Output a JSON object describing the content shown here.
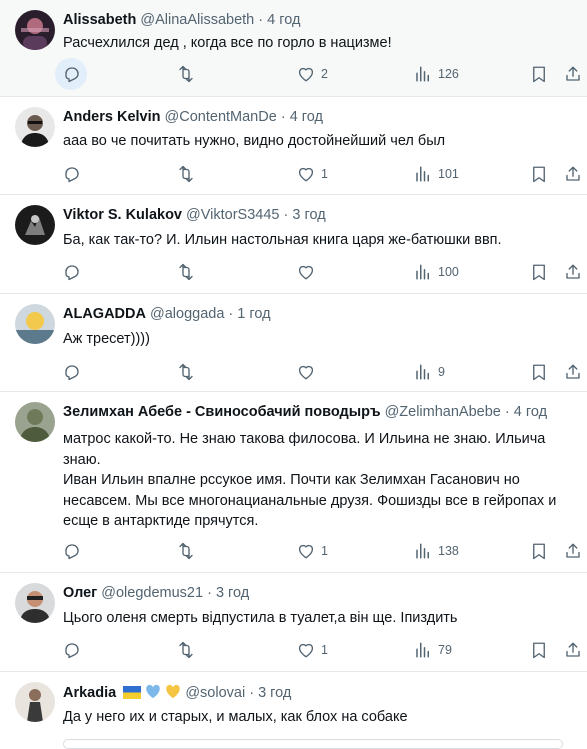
{
  "colors": {
    "text": "#0f1419",
    "muted": "#536471",
    "divider": "#e6e9eb",
    "highlight": "#f7f9f9",
    "reply_highlight": "#e2eef9"
  },
  "replies": [
    {
      "name": "Alissabeth",
      "handle": "@AlinaAlissabeth",
      "dot": "·",
      "time": "4 год",
      "lines": [
        "Расчехлился дед , когда все по горло в нацизме!"
      ],
      "counts": {
        "replies": "",
        "retweets": "",
        "likes": "2",
        "views": "126"
      },
      "highlighted": true
    },
    {
      "name": "Anders Kelvin",
      "handle": "@ContentManDe",
      "dot": "·",
      "time": "4 год",
      "lines": [
        "ааа во че почитать нужно, видно достойнейший чел был"
      ],
      "counts": {
        "replies": "",
        "retweets": "",
        "likes": "1",
        "views": "101"
      }
    },
    {
      "name": "Viktor S. Kulakov",
      "handle": "@ViktorS3445",
      "dot": "·",
      "time": "3 год",
      "lines": [
        "Ба, как так-то? И. Ильин настольная книга царя же-батюшки ввп."
      ],
      "counts": {
        "replies": "",
        "retweets": "",
        "likes": "",
        "views": "100"
      }
    },
    {
      "name": "ALAGADDA",
      "handle": "@aloggada",
      "dot": "·",
      "time": "1 год",
      "lines": [
        "Аж тресет))))"
      ],
      "counts": {
        "replies": "",
        "retweets": "",
        "likes": "",
        "views": "9"
      }
    },
    {
      "name": "Зелимхан Абебе - Свинособачий поводыръ",
      "handle": "@ZelimhanAbebe",
      "dot": "·",
      "time": "4 год",
      "lines": [
        "матрос какой-то. Не знаю такова филосова. И Ильина не знаю. Ильича",
        "знаю.",
        "Иван Ильин впалне рссукое имя. Почти как Зелимхан Гасанович но",
        "несавсем. Мы все многонацианальные друзя. Фошизды все в гейропах и",
        "есще в антарктиде прячутся."
      ],
      "counts": {
        "replies": "",
        "retweets": "",
        "likes": "1",
        "views": "138"
      }
    },
    {
      "name": "Олег",
      "handle": "@olegdemus21",
      "dot": "·",
      "time": "3 год",
      "lines": [
        "Цього оленя смерть відпустила в  туалет,а він ще. Іпиздить"
      ],
      "counts": {
        "replies": "",
        "retweets": "",
        "likes": "1",
        "views": "79"
      }
    },
    {
      "name": "Arkadia",
      "handle": "@solovai",
      "dot": "·",
      "time": "3 год",
      "flag_icons": [
        "ukraine-flag-icon",
        "blue-heart-icon",
        "yellow-heart-icon"
      ],
      "lines": [
        "Да у него их и старых, и малых, как блох на собаке"
      ]
    }
  ]
}
